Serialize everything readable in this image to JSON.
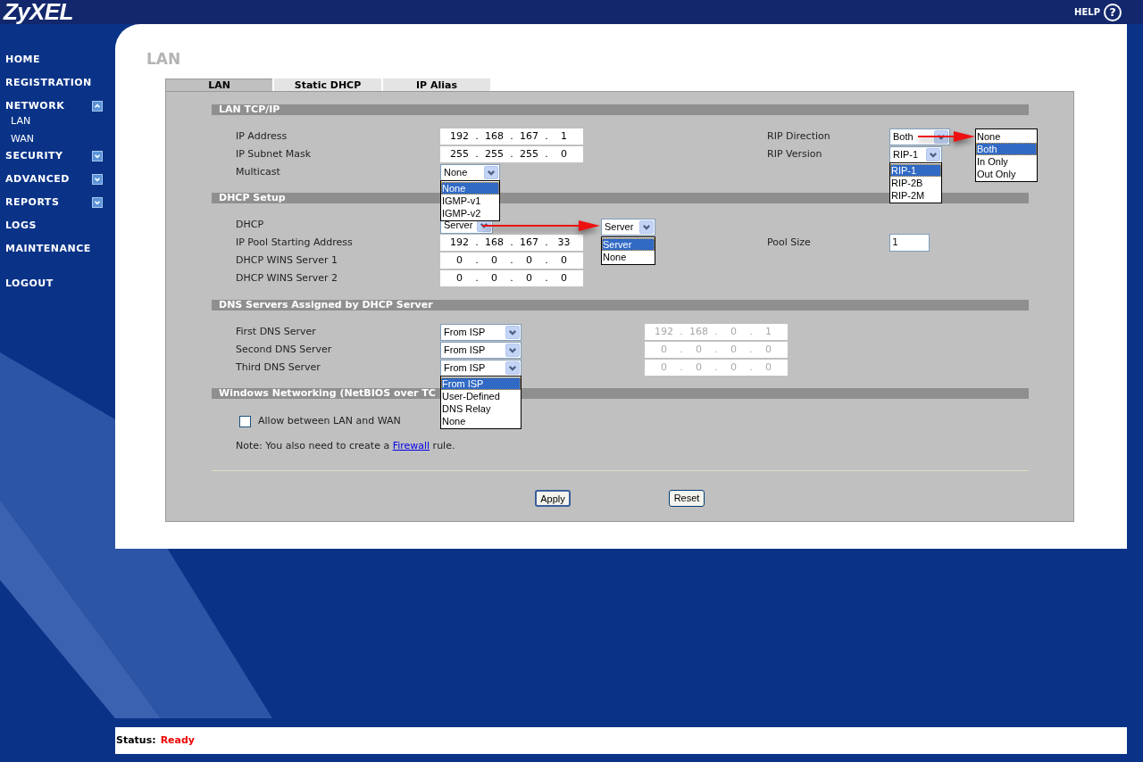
{
  "header": {
    "logo": "ZyXEL",
    "help_label": "HELP",
    "help_icon": "?"
  },
  "sidebar": {
    "items": [
      {
        "label": "HOME",
        "kind": "link"
      },
      {
        "label": "REGISTRATION",
        "kind": "link"
      },
      {
        "label": "NETWORK",
        "kind": "group",
        "expanded": true,
        "children": [
          {
            "label": "LAN"
          },
          {
            "label": "WAN"
          }
        ]
      },
      {
        "label": "SECURITY",
        "kind": "group",
        "expanded": false
      },
      {
        "label": "ADVANCED",
        "kind": "group",
        "expanded": false
      },
      {
        "label": "REPORTS",
        "kind": "group",
        "expanded": false
      },
      {
        "label": "LOGS",
        "kind": "link"
      },
      {
        "label": "MAINTENANCE",
        "kind": "link"
      },
      {
        "label": "LOGOUT",
        "kind": "logout"
      }
    ]
  },
  "page_title": "LAN",
  "tabs": [
    {
      "label": "LAN",
      "selected": true
    },
    {
      "label": "Static DHCP",
      "selected": false
    },
    {
      "label": "IP Alias",
      "selected": false
    }
  ],
  "sections": [
    {
      "kind": "form",
      "title": "LAN TCP/IP",
      "rows": [
        {
          "label": "IP Address",
          "field": {
            "kind": "ip",
            "disabled": false,
            "octets": [
              "192",
              ".",
              "168",
              ".",
              "167",
              ".",
              "1"
            ]
          },
          "side": {
            "label": "RIP Direction",
            "field": {
              "kind": "select",
              "value": "Both",
              "callout": {
                "options": [
                  {
                    "label": "None",
                    "selected": false
                  },
                  {
                    "label": "Both",
                    "selected": true
                  },
                  {
                    "label": "In Only",
                    "selected": false
                  },
                  {
                    "label": "Out Only",
                    "selected": false
                  }
                ]
              }
            }
          }
        },
        {
          "label": "IP Subnet Mask",
          "field": {
            "kind": "ip",
            "disabled": false,
            "octets": [
              "255",
              ".",
              "255",
              ".",
              "255",
              ".",
              "0"
            ]
          },
          "side": {
            "label": "RIP Version",
            "field": {
              "kind": "select",
              "value": "RIP-1",
              "options": [
                {
                  "label": "RIP-1",
                  "selected": true
                },
                {
                  "label": "RIP-2B",
                  "selected": false
                },
                {
                  "label": "RIP-2M",
                  "selected": false
                }
              ]
            }
          }
        },
        {
          "label": "Multicast",
          "field": {
            "kind": "select",
            "value": "None",
            "options": [
              {
                "label": "None",
                "selected": true
              },
              {
                "label": "IGMP-v1",
                "selected": false
              },
              {
                "label": "IGMP-v2",
                "selected": false
              }
            ]
          }
        }
      ]
    },
    {
      "kind": "form",
      "title": "DHCP Setup",
      "rows": [
        {
          "label": "DHCP",
          "field": {
            "kind": "select",
            "value": "Server",
            "callout": {
              "value": "Server",
              "options": [
                {
                  "label": "Server",
                  "selected": true
                },
                {
                  "label": "None",
                  "selected": false
                }
              ]
            }
          }
        },
        {
          "label": "IP Pool Starting Address",
          "field": {
            "kind": "ip",
            "disabled": false,
            "octets": [
              "192",
              ".",
              "168",
              ".",
              "167",
              ".",
              "33"
            ]
          },
          "side": {
            "label": "Pool Size",
            "field": {
              "kind": "text",
              "value": "1"
            }
          }
        },
        {
          "label": "DHCP WINS Server 1",
          "field": {
            "kind": "ip",
            "disabled": false,
            "octets": [
              "0",
              ".",
              "0",
              ".",
              "0",
              ".",
              "0"
            ]
          }
        },
        {
          "label": "DHCP WINS Server 2",
          "field": {
            "kind": "ip",
            "disabled": false,
            "octets": [
              "0",
              ".",
              "0",
              ".",
              "0",
              ".",
              "0"
            ]
          }
        }
      ]
    },
    {
      "kind": "form",
      "title": "DNS Servers Assigned by DHCP Server",
      "rows": [
        {
          "label": "First DNS Server",
          "field": {
            "kind": "select",
            "value": "From ISP"
          },
          "extra": {
            "kind": "ip",
            "disabled": true,
            "octets": [
              "192",
              ".",
              "168",
              ".",
              "0",
              ".",
              "1"
            ]
          }
        },
        {
          "label": "Second DNS Server",
          "field": {
            "kind": "select",
            "value": "From ISP"
          },
          "extra": {
            "kind": "ip",
            "disabled": true,
            "octets": [
              "0",
              ".",
              "0",
              ".",
              "0",
              ".",
              "0"
            ]
          }
        },
        {
          "label": "Third DNS Server",
          "field": {
            "kind": "select",
            "value": "From ISP",
            "options": [
              {
                "label": "From ISP",
                "selected": true
              },
              {
                "label": "User-Defined",
                "selected": false
              },
              {
                "label": "DNS Relay",
                "selected": false
              },
              {
                "label": "None",
                "selected": false
              }
            ]
          },
          "extra": {
            "kind": "ip",
            "disabled": true,
            "octets": [
              "0",
              ".",
              "0",
              ".",
              "0",
              ".",
              "0"
            ]
          }
        }
      ]
    },
    {
      "kind": "netbios",
      "title": "Windows Networking (NetBIOS over TC",
      "checkbox": {
        "label": "Allow between LAN and WAN",
        "checked": false
      },
      "note": {
        "before": "Note: You also need to create a ",
        "link": "Firewall",
        "after": " rule."
      }
    }
  ],
  "buttons": [
    {
      "label": "Apply",
      "focused": true
    },
    {
      "label": "Reset",
      "focused": false
    }
  ],
  "status": {
    "label": "Status:",
    "value": "Ready"
  }
}
